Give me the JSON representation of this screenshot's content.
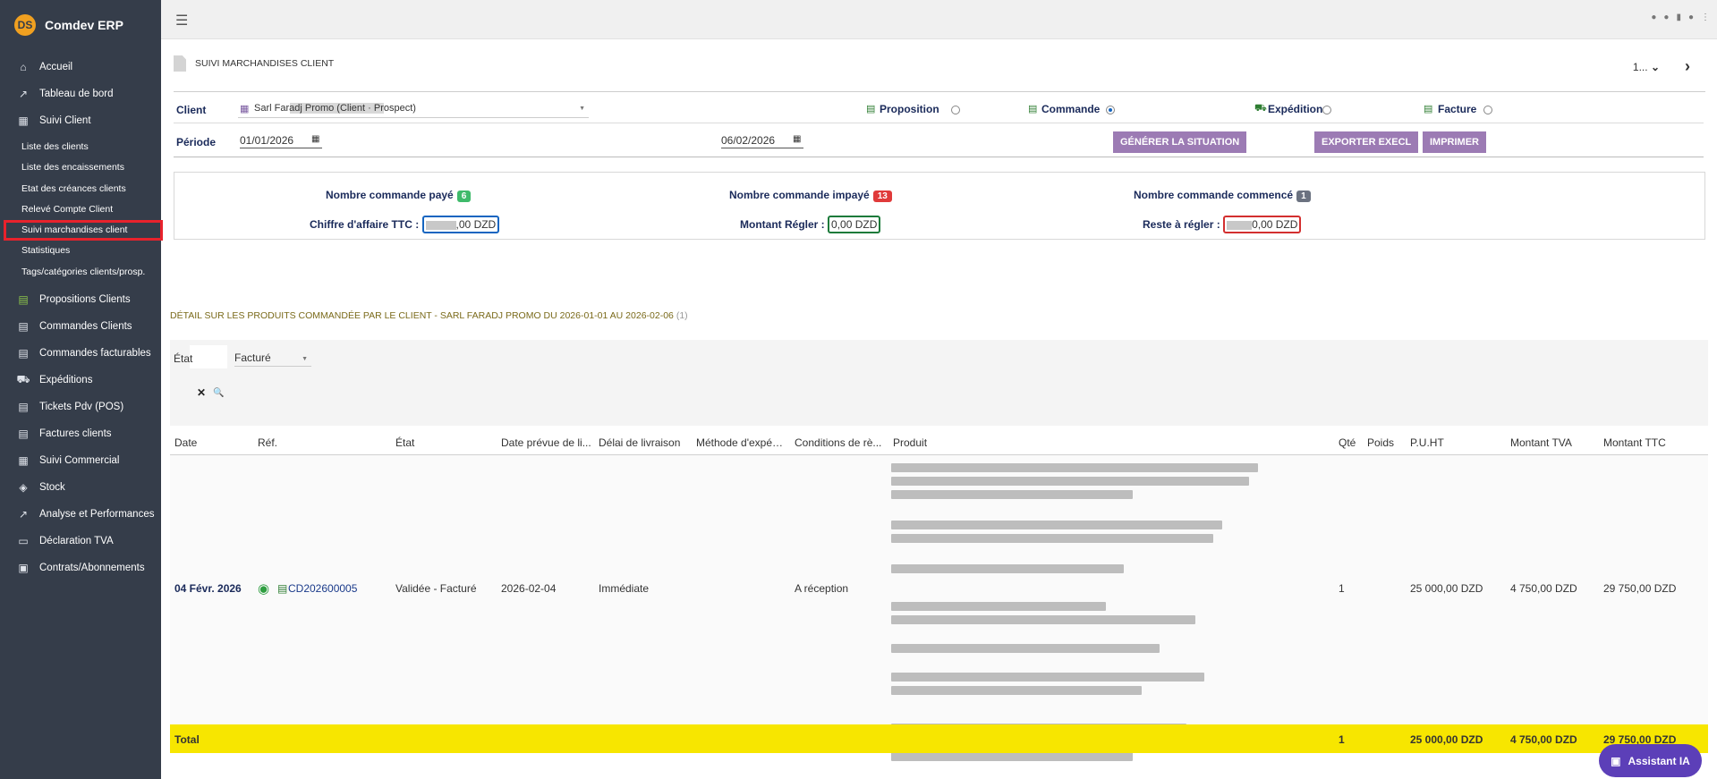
{
  "brand": {
    "logo_text": "DS",
    "name": "Comdev ERP"
  },
  "sidebar": {
    "items": [
      {
        "label": "Accueil",
        "icon": "home-icon",
        "glyph": "⌂"
      },
      {
        "label": "Tableau de bord",
        "icon": "chart-line-icon",
        "glyph": "↗"
      },
      {
        "label": "Suivi Client",
        "icon": "building-icon",
        "glyph": "▦"
      }
    ],
    "sub_items": [
      "Liste des clients",
      "Liste des encaissements",
      "Etat des créances clients",
      "Relevé Compte Client",
      "Suivi marchandises client",
      "Statistiques",
      "Tags/catégories clients/prosp."
    ],
    "items2": [
      {
        "label": "Propositions Clients",
        "icon": "file-icon",
        "glyph": "▤"
      },
      {
        "label": "Commandes Clients",
        "icon": "file-icon",
        "glyph": "▤"
      },
      {
        "label": "Commandes facturables",
        "icon": "file-icon",
        "glyph": "▤"
      },
      {
        "label": "Expéditions",
        "icon": "dolly-icon",
        "glyph": "⛟"
      },
      {
        "label": "Tickets Pdv (POS)",
        "icon": "ticket-icon",
        "glyph": "▤"
      },
      {
        "label": "Factures clients",
        "icon": "file-icon",
        "glyph": "▤"
      },
      {
        "label": "Suivi Commercial",
        "icon": "building-icon",
        "glyph": "▦"
      },
      {
        "label": "Stock",
        "icon": "box-icon",
        "glyph": "◈"
      },
      {
        "label": "Analyse et Performances",
        "icon": "chart-line-icon",
        "glyph": "↗"
      },
      {
        "label": "Déclaration TVA",
        "icon": "card-icon",
        "glyph": "▭"
      },
      {
        "label": "Contrats/Abonnements",
        "icon": "briefcase-icon",
        "glyph": "▣"
      }
    ]
  },
  "header": {
    "page_title": "SUIVI MARCHANDISES CLIENT",
    "pager_value": "1...",
    "pager_caret": "⌄",
    "pager_next": "›"
  },
  "filters": {
    "client_label": "Client",
    "client_value": "Sarl Faradj Promo (Client · Prospect)",
    "proposition_label": "Proposition",
    "commande_label": "Commande",
    "expedition_label": "Expédition",
    "facture_label": "Facture",
    "periode_label": "Période",
    "date_from": "01/01/2026",
    "date_to": "06/02/2026"
  },
  "buttons": {
    "generer": "Générer la situation",
    "exporter": "Exporter Execl",
    "imprimer": "Imprimer"
  },
  "summary": {
    "paye_label": "Nombre commande payé",
    "paye_count": "6",
    "impaye_label": "Nombre commande impayé",
    "impaye_count": "13",
    "commence_label": "Nombre commande commencé",
    "commence_count": "1",
    "ca_label": "Chiffre d'affaire TTC :",
    "ca_value": ",00 DZD",
    "regler_label": "Montant Régler :",
    "regler_value": "0,00 DZD",
    "reste_label": "Reste à régler :",
    "reste_value": "0,00 DZD"
  },
  "detail": {
    "title": "DÉTAIL SUR LES PRODUITS COMMANDÉE PAR LE CLIENT - SARL FARADJ PROMO DU 2026-01-01 AU 2026-02-06",
    "count": "(1)",
    "etat_filter_label": "État",
    "etat_filter_value": "Facturé",
    "clear_icon": "✕",
    "search_icon": "🔍"
  },
  "table": {
    "headers": [
      "Date",
      "Réf.",
      "État",
      "Date prévue de li...",
      "Délai de livraison",
      "Méthode d'expéd...",
      "Conditions de rè...",
      "Produit",
      "Qté",
      "Poids",
      "P.U.HT",
      "Montant TVA",
      "Montant TTC"
    ],
    "row": {
      "date": "04 Févr. 2026",
      "ref": "CD202600005",
      "etat": "Validée - Facturé",
      "date_prevue": "2026-02-04",
      "delai": "Immédiate",
      "methode": "",
      "conditions": "A réception",
      "qte": "1",
      "poids": "",
      "puht": "25 000,00 DZD",
      "tva": "4 750,00 DZD",
      "ttc": "29 750,00 DZD"
    },
    "total": {
      "label": "Total",
      "qte": "1",
      "puht": "25 000,00 DZD",
      "tva": "4 750,00 DZD",
      "ttc": "29 750,00 DZD"
    }
  },
  "assistant": {
    "label": "Assistant IA"
  },
  "colors": {
    "sidebar_bg": "#353d4a",
    "button_purple": "#9c7bb4",
    "badge_green": "#3fba6a",
    "badge_red": "#e03a3a",
    "badge_gray": "#6b7280",
    "total_yellow": "#f7e600",
    "ia_purple": "#5c3fb8"
  }
}
